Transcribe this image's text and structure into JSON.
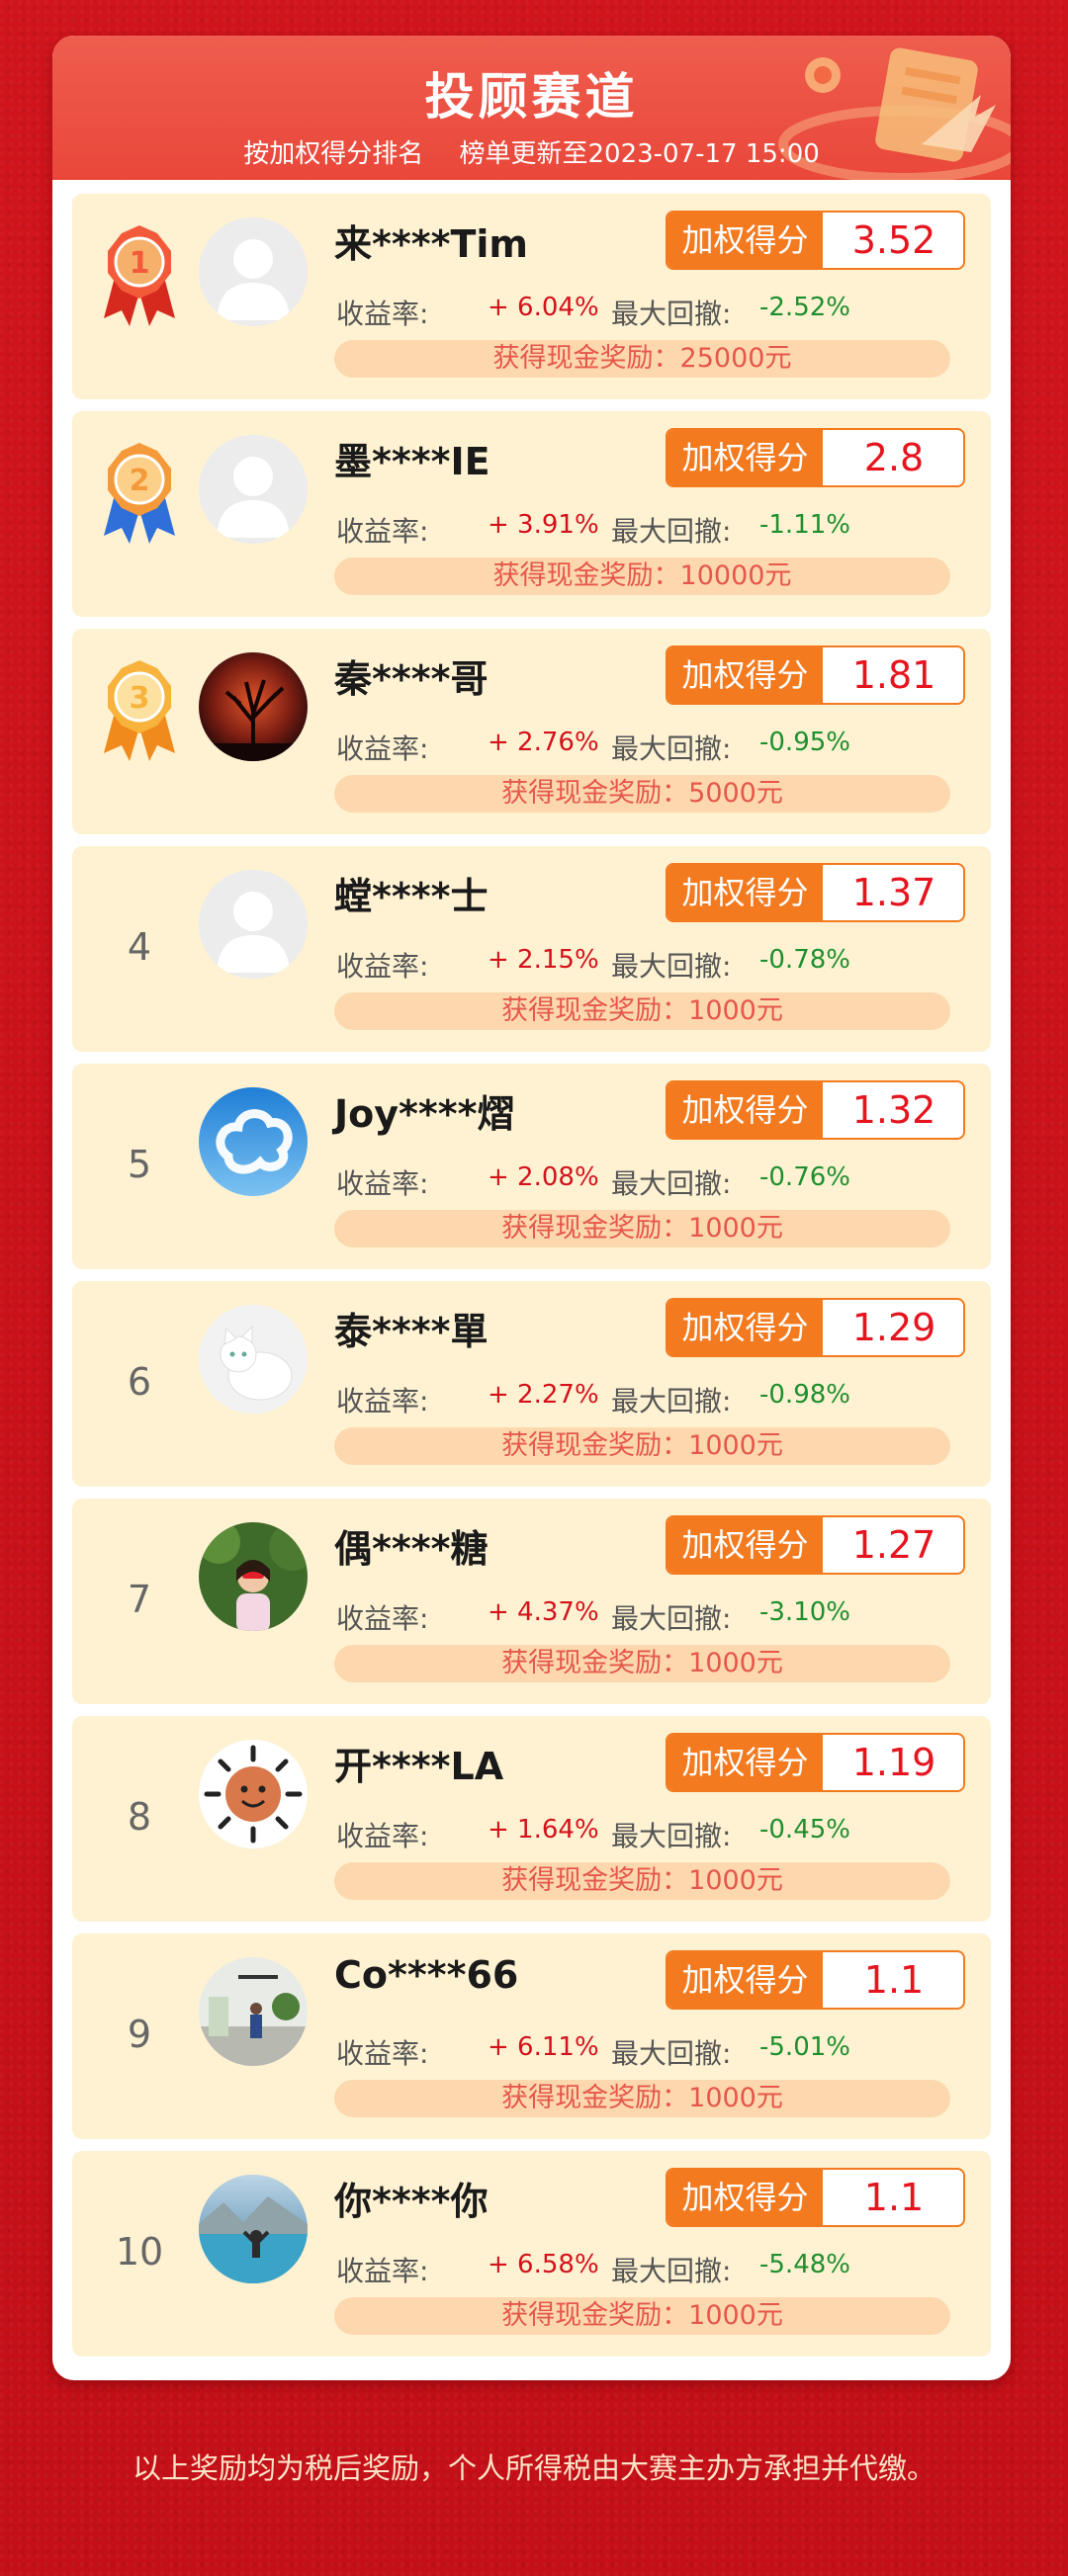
{
  "header": {
    "title": "投顾赛道",
    "rank_by": "按加权得分排名",
    "updated": "榜单更新至2023-07-17 15:00"
  },
  "labels": {
    "score": "加权得分",
    "return": "收益率:",
    "drawdown": "最大回撤:"
  },
  "rows": [
    {
      "rank": "1",
      "name": "来****Tim",
      "score": "3.52",
      "return": "+ 6.04%",
      "drawdown": "-2.52%",
      "reward": "获得现金奖励：25000元",
      "avatar": "default-avatar",
      "medal": "gold-red"
    },
    {
      "rank": "2",
      "name": "墨****IE",
      "score": "2.8",
      "return": "+ 3.91%",
      "drawdown": "-1.11%",
      "reward": "获得现金奖励：10000元",
      "avatar": "default-avatar",
      "medal": "orange-blue"
    },
    {
      "rank": "3",
      "name": "秦****哥",
      "score": "1.81",
      "return": "+ 2.76%",
      "drawdown": "-0.95%",
      "reward": "获得现金奖励：5000元",
      "avatar": "tree-sunset-avatar",
      "medal": "yellow-orange"
    },
    {
      "rank": "4",
      "name": "螳****士",
      "score": "1.37",
      "return": "+ 2.15%",
      "drawdown": "-0.78%",
      "reward": "获得现金奖励：1000元",
      "avatar": "default-avatar"
    },
    {
      "rank": "5",
      "name": "Joy****熠",
      "score": "1.32",
      "return": "+ 2.08%",
      "drawdown": "-0.76%",
      "reward": "获得现金奖励：1000元",
      "avatar": "cloud-sky-avatar"
    },
    {
      "rank": "6",
      "name": "泰****單",
      "score": "1.29",
      "return": "+ 2.27%",
      "drawdown": "-0.98%",
      "reward": "获得现金奖励：1000元",
      "avatar": "white-cat-avatar"
    },
    {
      "rank": "7",
      "name": "偶****糖",
      "score": "1.27",
      "return": "+ 4.37%",
      "drawdown": "-3.10%",
      "reward": "获得现金奖励：1000元",
      "avatar": "girl-tree-avatar"
    },
    {
      "rank": "8",
      "name": "开****LA",
      "score": "1.19",
      "return": "+ 1.64%",
      "drawdown": "-0.45%",
      "reward": "获得现金奖励：1000元",
      "avatar": "sun-face-avatar"
    },
    {
      "rank": "9",
      "name": "Co****66",
      "score": "1.1",
      "return": "+ 6.11%",
      "drawdown": "-5.01%",
      "reward": "获得现金奖励：1000元",
      "avatar": "room-person-avatar"
    },
    {
      "rank": "10",
      "name": "你****你",
      "score": "1.1",
      "return": "+ 6.58%",
      "drawdown": "-5.48%",
      "reward": "获得现金奖励：1000元",
      "avatar": "lake-person-avatar"
    }
  ],
  "footer": "以上奖励均为税后奖励，个人所得税由大赛主办方承担并代缴。",
  "colors": {
    "background": "#c8101a",
    "header": "#ea4b3d",
    "row": "#fef2d2",
    "accent": "#f47a1f",
    "score": "#e6141f",
    "positive": "#d3121c",
    "negative": "#1e8f2e",
    "reward_bg": "#fdd8ae",
    "reward_text": "#e5574a"
  }
}
